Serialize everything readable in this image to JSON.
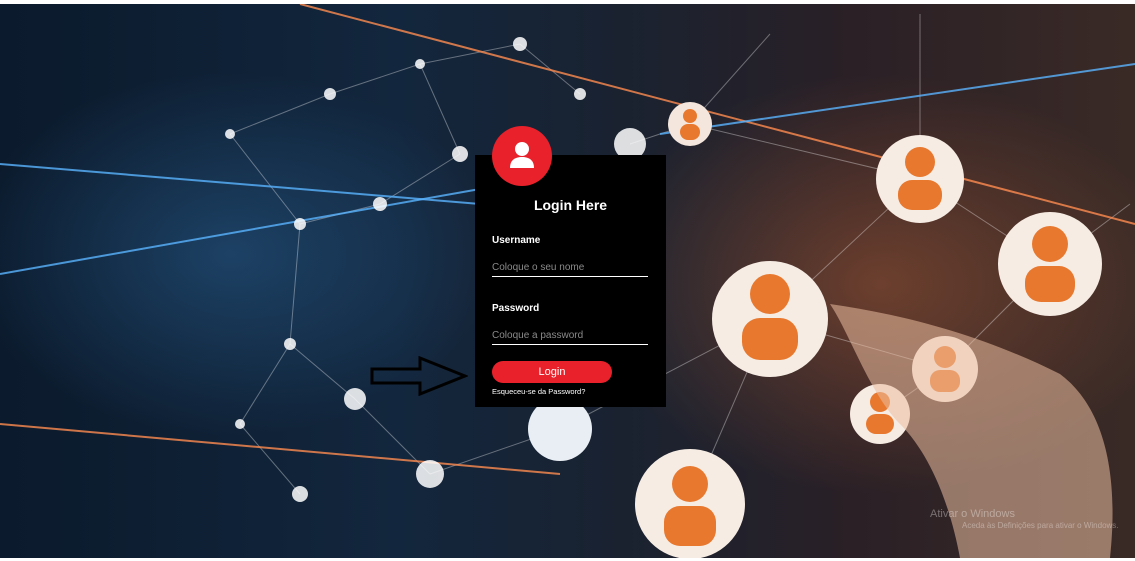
{
  "login": {
    "title": "Login Here",
    "username_label": "Username",
    "username_placeholder": "Coloque o seu nome",
    "password_label": "Password",
    "password_placeholder": "Coloque a password",
    "button_label": "Login",
    "forgot_link": "Esqueceu-se da Password?"
  },
  "watermark": {
    "line1": "Ativar o Windows",
    "line2": "Aceda às Definições para ativar o Windows."
  },
  "colors": {
    "accent": "#e8212a",
    "panel": "#000000"
  },
  "icons": {
    "avatar": "user-icon",
    "annotation": "arrow-right-icon"
  }
}
